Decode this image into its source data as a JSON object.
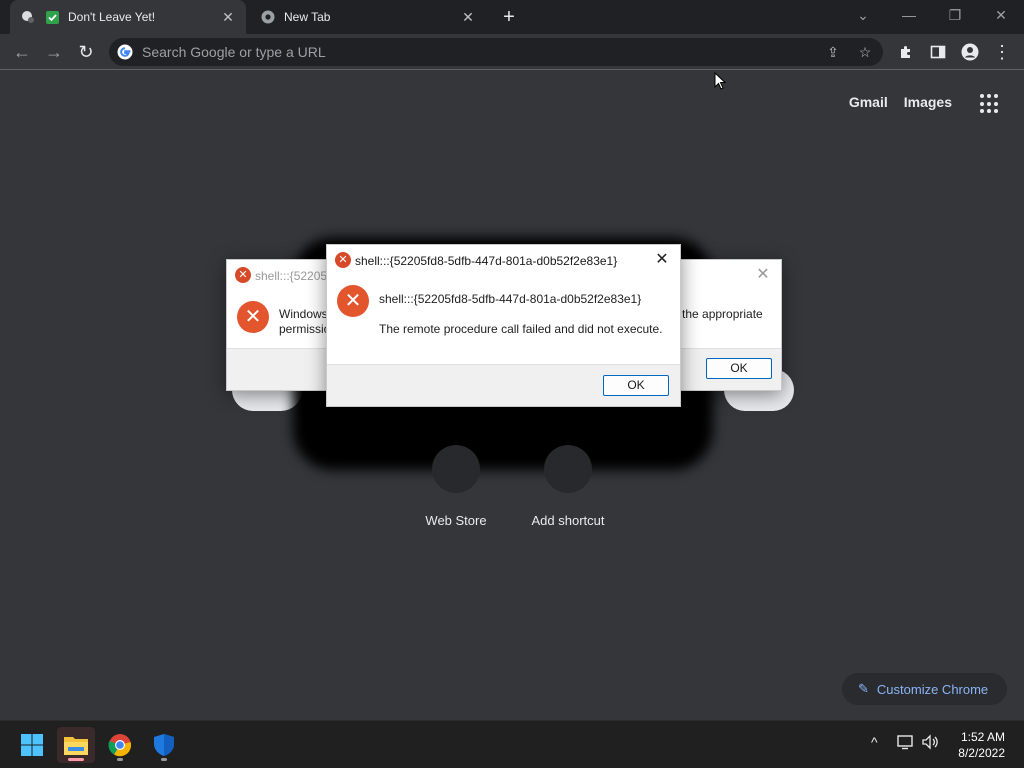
{
  "tabs": [
    {
      "title": "Don't Leave Yet!"
    },
    {
      "title": "New Tab"
    }
  ],
  "window_controls": {
    "menu": "⌄",
    "minimize": "—",
    "restore": "❐",
    "close": "✕"
  },
  "toolbar": {
    "back": "←",
    "forward": "→",
    "reload": "↻",
    "placeholder": "Search Google or type a URL"
  },
  "ntp": {
    "links": [
      "Gmail",
      "Images"
    ],
    "shortcuts": [
      {
        "label": "Web Store"
      },
      {
        "label": "Add shortcut"
      }
    ],
    "customize": "Customize Chrome"
  },
  "bg_dialog": {
    "title": "shell:::{52205f",
    "line1": "Windows",
    "line2": "permissio",
    "line3": "the appropriate",
    "ok": "OK"
  },
  "fg_dialog": {
    "title": "shell:::{52205fd8-5dfb-447d-801a-d0b52f2e83e1}",
    "heading": "shell:::{52205fd8-5dfb-447d-801a-d0b52f2e83e1}",
    "message": "The remote procedure call failed and did not execute.",
    "ok": "OK"
  },
  "taskbar": {
    "time": "1:52 AM",
    "date": "8/2/2022"
  },
  "colors": {
    "chrome_dark": "#202124",
    "ntp_bg": "#35363a",
    "accent_blue": "#8ab4f8",
    "error_red": "#e2552d"
  }
}
